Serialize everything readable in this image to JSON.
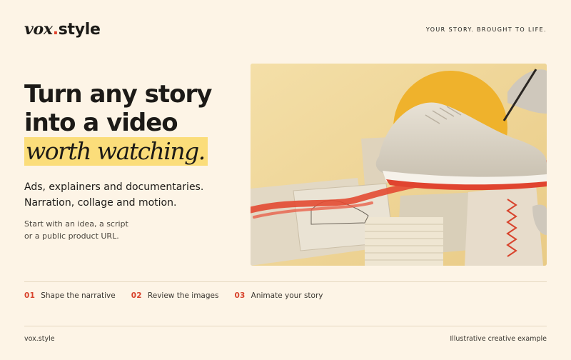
{
  "brand": {
    "name_part1": "vox",
    "dot": ".",
    "name_part2": "style"
  },
  "header": {
    "tagline": "YOUR STORY. BROUGHT TO LIFE."
  },
  "hero": {
    "headline_line1": "Turn any story",
    "headline_line2": "into a video",
    "headline_highlight": "worth watching.",
    "sub_line1": "Ads, explainers and documentaries.",
    "sub_line2": "Narration, collage and motion.",
    "hint_line1": "Start with an idea, a script",
    "hint_line2": "or a public product URL."
  },
  "steps": [
    {
      "num": "01",
      "label": "Shape the narrative"
    },
    {
      "num": "02",
      "label": "Review the images"
    },
    {
      "num": "03",
      "label": "Animate your story"
    }
  ],
  "footer": {
    "left": "vox.style",
    "right": "Illustrative creative example"
  },
  "colors": {
    "background": "#fdf4e6",
    "accent": "#e0442f",
    "highlight": "#fbdd7a",
    "sun": "#efb22c"
  },
  "image": {
    "description_icon": "sneaker-collage-illustration"
  }
}
